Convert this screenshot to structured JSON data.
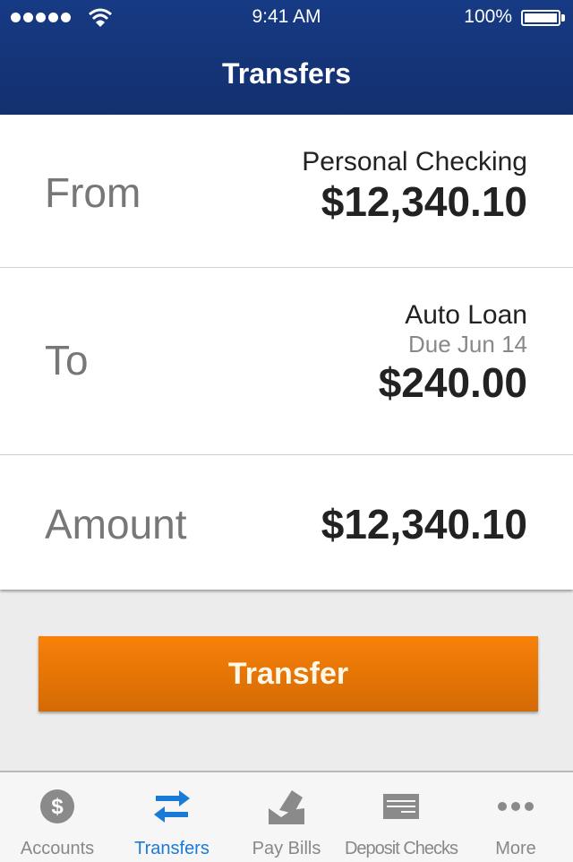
{
  "status_bar": {
    "time": "9:41 AM",
    "battery": "100%",
    "signal_bars": 5
  },
  "header": {
    "title": "Transfers"
  },
  "from": {
    "label": "From",
    "account": "Personal Checking",
    "balance": "$12,340.10"
  },
  "to": {
    "label": "To",
    "account": "Auto Loan",
    "due": "Due Jun 14",
    "amount": "$240.00"
  },
  "amount": {
    "label": "Amount",
    "value": "$12,340.10"
  },
  "transfer_button": {
    "label": "Transfer",
    "color": "#f07a08"
  },
  "tabs": [
    {
      "label": "Accounts",
      "icon": "dollar-icon"
    },
    {
      "label": "Transfers",
      "icon": "transfer-arrows-icon",
      "active": true
    },
    {
      "label": "Pay Bills",
      "icon": "pay-bills-icon"
    },
    {
      "label": "Deposit Checks",
      "icon": "check-icon"
    },
    {
      "label": "More",
      "icon": "more-icon"
    }
  ],
  "colors": {
    "header": "#163a84",
    "accent": "#1a7ad8",
    "inactive": "#888888"
  }
}
